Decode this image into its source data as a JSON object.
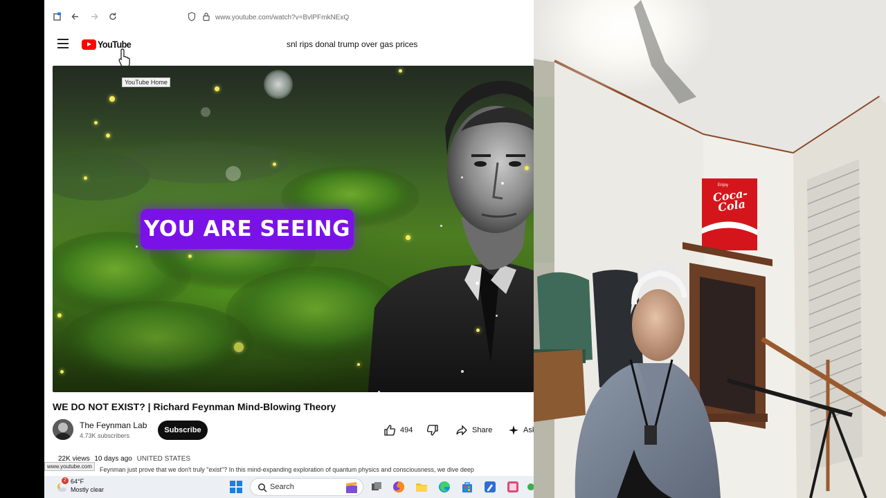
{
  "browser": {
    "url": "www.youtube.com/watch?v=BvlPFmkNExQ"
  },
  "youtube": {
    "logo_text": "YouTube",
    "search_query": "snl rips donal trump over gas prices",
    "tooltip": "YouTube Home",
    "video": {
      "overlay_text": "YOU ARE SEEING",
      "title": "WE DO NOT EXIST? | Richard Feynman Mind-Blowing Theory",
      "channel_name": "The Feynman Lab",
      "channel_subscribers": "4.73K subscribers",
      "subscribe_label": "Subscribe",
      "likes": "494",
      "share_label": "Share",
      "ask_label": "Ask",
      "views": "22K views",
      "age": "10 days ago",
      "country": "UNITED STATES",
      "description_snippet": "Feynman just prove that we don't truly \"exist\"? In this mind-expanding exploration of quantum physics and consciousness, we dive deep"
    },
    "status_url": "www.youtube.com"
  },
  "taskbar": {
    "weather_temp": "64°F",
    "weather_desc": "Mostly clear",
    "weather_badge": "2",
    "search_label": "Search"
  },
  "webcam": {
    "sign_small": "Enjoy",
    "sign_brand": "Coca-Cola"
  },
  "colors": {
    "youtube_red": "#ff0000",
    "banner_purple": "#7a12e8",
    "subscribe_bg": "#0f0f0f",
    "taskbar_bg": "#eceff3"
  }
}
